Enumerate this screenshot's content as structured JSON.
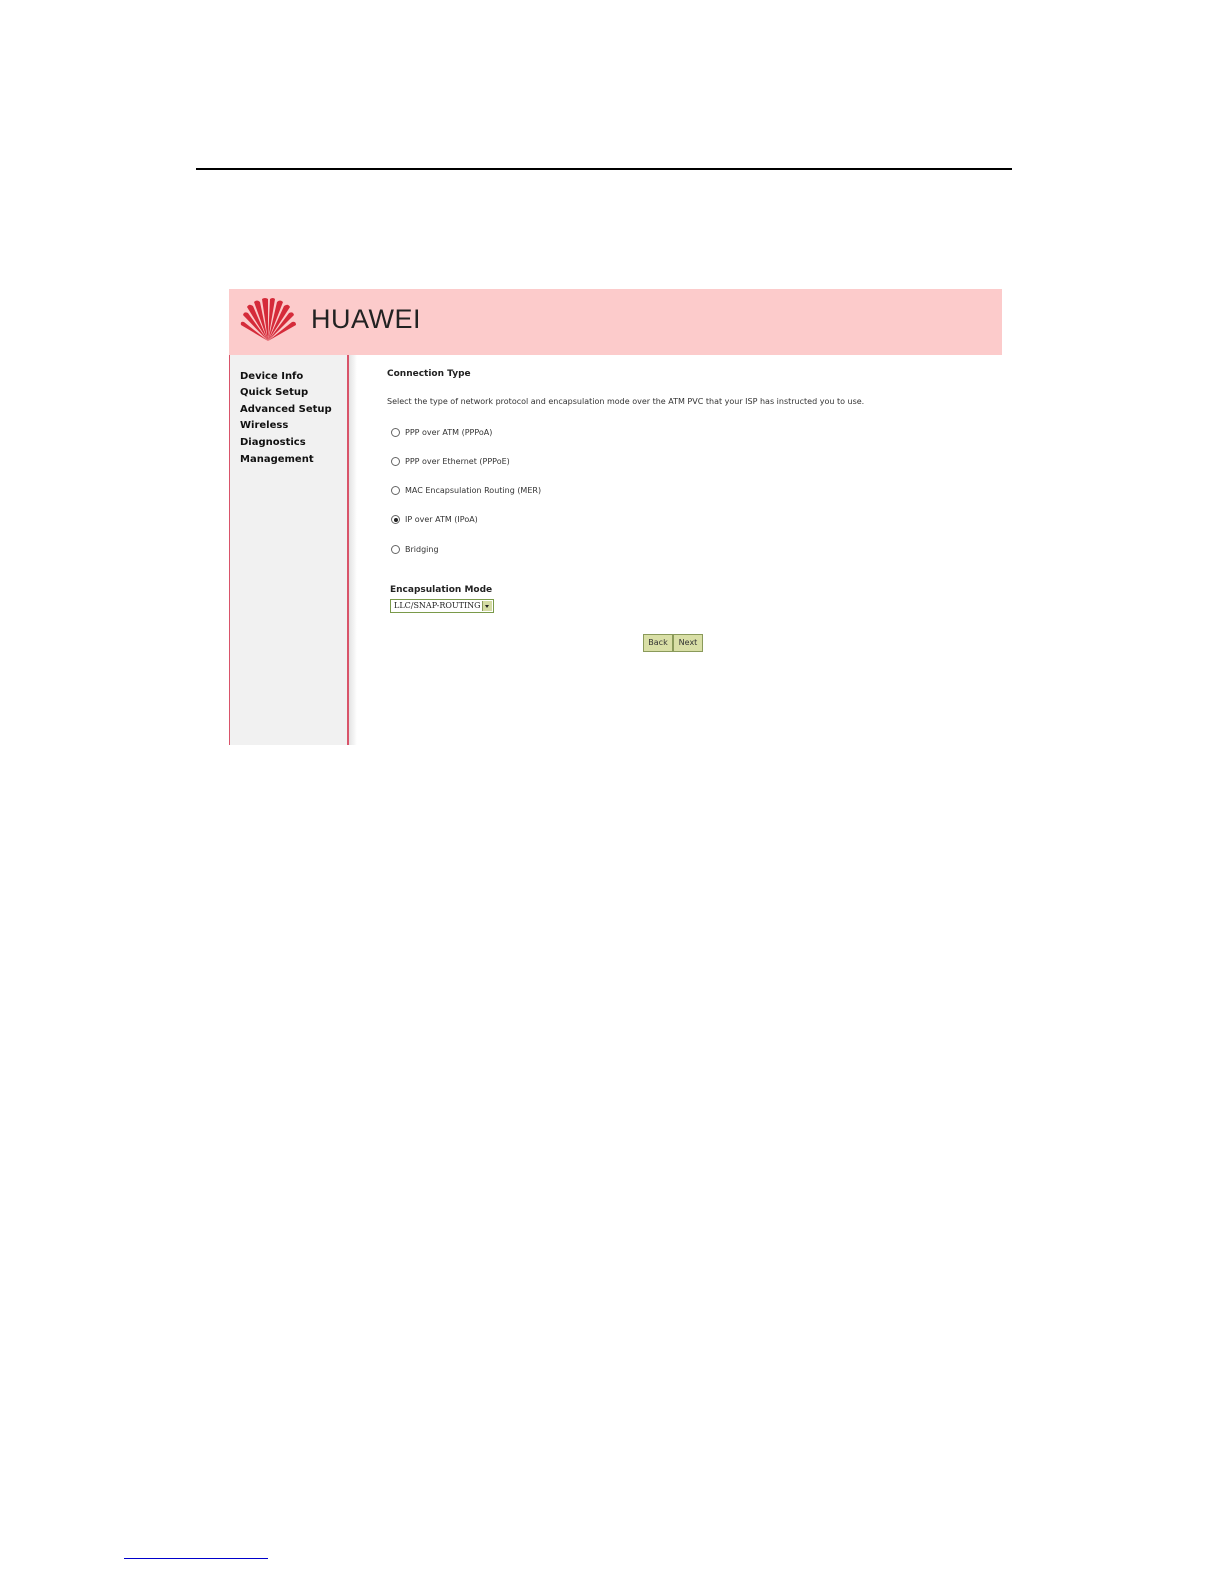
{
  "brand": {
    "name": "HUAWEI",
    "logo_icon": "huawei-petal-logo-icon",
    "banner_color": "#fccbcb",
    "logo_color": "#d52b3a"
  },
  "sidebar": {
    "items": [
      {
        "label": "Device Info"
      },
      {
        "label": "Quick Setup"
      },
      {
        "label": "Advanced Setup"
      },
      {
        "label": "Wireless"
      },
      {
        "label": "Diagnostics"
      },
      {
        "label": "Management"
      }
    ]
  },
  "main": {
    "title": "Connection Type",
    "instructions": "Select the type of network protocol and encapsulation mode over the ATM PVC that your ISP has instructed you to use.",
    "connection_options": [
      {
        "label": "PPP over ATM (PPPoA)",
        "checked": false
      },
      {
        "label": "PPP over Ethernet (PPPoE)",
        "checked": false
      },
      {
        "label": "MAC Encapsulation Routing (MER)",
        "checked": false
      },
      {
        "label": "IP over ATM (IPoA)",
        "checked": true
      },
      {
        "label": "Bridging",
        "checked": false
      }
    ],
    "encapsulation": {
      "label": "Encapsulation Mode",
      "selected": "LLC/SNAP-ROUTING"
    },
    "buttons": {
      "back": "Back",
      "next": "Next"
    }
  }
}
